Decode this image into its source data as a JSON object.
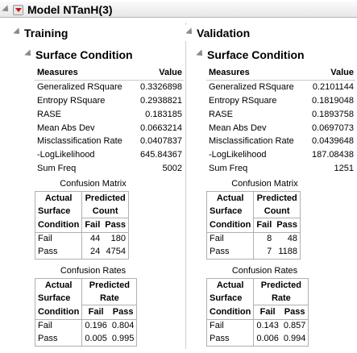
{
  "model_title": "Model NTanH(3)",
  "panels": [
    {
      "key": "training",
      "title": "Training",
      "section_title": "Surface Condition",
      "measures_header": "Measures",
      "value_header": "Value",
      "measures": [
        {
          "label": "Generalized RSquare",
          "value": "0.3326898"
        },
        {
          "label": "Entropy RSquare",
          "value": "0.2938821"
        },
        {
          "label": "RASE",
          "value": "0.183185"
        },
        {
          "label": "Mean Abs Dev",
          "value": "0.0663214"
        },
        {
          "label": "Misclassification Rate",
          "value": "0.0407837"
        },
        {
          "label": "-LogLikelihood",
          "value": "645.84367"
        },
        {
          "label": "Sum Freq",
          "value": "5002"
        }
      ],
      "matrix": {
        "caption": "Confusion Matrix",
        "actual_l1": "Actual",
        "actual_l2": "Surface",
        "actual_l3": "Condition",
        "pred_l1": "Predicted",
        "pred_l2": "Count",
        "cols": [
          "Fail",
          "Pass"
        ],
        "rows": [
          {
            "label": "Fail",
            "v1": "44",
            "v2": "180"
          },
          {
            "label": "Pass",
            "v1": "24",
            "v2": "4754"
          }
        ]
      },
      "rates": {
        "caption": "Confusion Rates",
        "actual_l1": "Actual",
        "actual_l2": "Surface",
        "actual_l3": "Condition",
        "pred_l1": "Predicted",
        "pred_l2": "Rate",
        "cols": [
          "Fail",
          "Pass"
        ],
        "rows": [
          {
            "label": "Fail",
            "v1": "0.196",
            "v2": "0.804"
          },
          {
            "label": "Pass",
            "v1": "0.005",
            "v2": "0.995"
          }
        ]
      }
    },
    {
      "key": "validation",
      "title": "Validation",
      "section_title": "Surface Condition",
      "measures_header": "Measures",
      "value_header": "Value",
      "measures": [
        {
          "label": "Generalized RSquare",
          "value": "0.2101144"
        },
        {
          "label": "Entropy RSquare",
          "value": "0.1819048"
        },
        {
          "label": "RASE",
          "value": "0.1893758"
        },
        {
          "label": "Mean Abs Dev",
          "value": "0.0697073"
        },
        {
          "label": "Misclassification Rate",
          "value": "0.0439648"
        },
        {
          "label": "-LogLikelihood",
          "value": "187.08438"
        },
        {
          "label": "Sum Freq",
          "value": "1251"
        }
      ],
      "matrix": {
        "caption": "Confusion Matrix",
        "actual_l1": "Actual",
        "actual_l2": "Surface",
        "actual_l3": "Condition",
        "pred_l1": "Predicted",
        "pred_l2": "Count",
        "cols": [
          "Fail",
          "Pass"
        ],
        "rows": [
          {
            "label": "Fail",
            "v1": "8",
            "v2": "48"
          },
          {
            "label": "Pass",
            "v1": "7",
            "v2": "1188"
          }
        ]
      },
      "rates": {
        "caption": "Confusion Rates",
        "actual_l1": "Actual",
        "actual_l2": "Surface",
        "actual_l3": "Condition",
        "pred_l1": "Predicted",
        "pred_l2": "Rate",
        "cols": [
          "Fail",
          "Pass"
        ],
        "rows": [
          {
            "label": "Fail",
            "v1": "0.143",
            "v2": "0.857"
          },
          {
            "label": "Pass",
            "v1": "0.006",
            "v2": "0.994"
          }
        ]
      }
    }
  ]
}
